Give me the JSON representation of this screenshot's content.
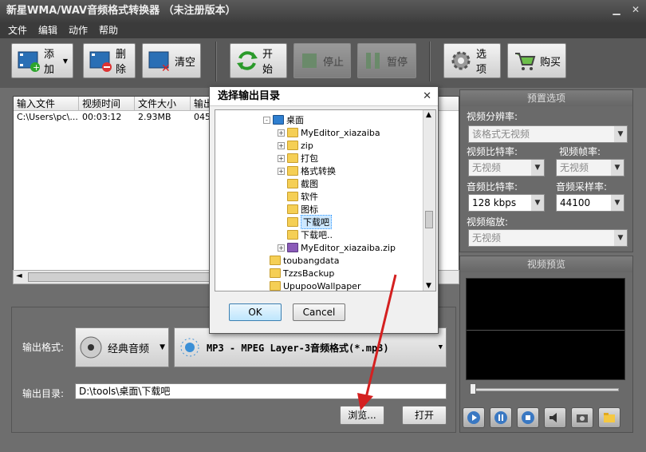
{
  "window": {
    "title": "新星WMA/WAV音频格式转换器 （未注册版本）",
    "min_icon": "minimize-icon",
    "close_icon": "close-icon"
  },
  "menu": [
    "文件",
    "编辑",
    "动作",
    "帮助"
  ],
  "toolbar": {
    "add": "添加",
    "delete": "删除",
    "clear": "清空",
    "start": "开始",
    "stop": "停止",
    "pause": "暂停",
    "options": "选项",
    "buy": "购买"
  },
  "table": {
    "columns": [
      "输入文件",
      "视频时间",
      "文件大小",
      "输出"
    ],
    "rows": [
      [
        "C:\\Users\\pc\\...",
        "00:03:12",
        "2.93MB",
        "045"
      ]
    ]
  },
  "preset": {
    "title": "预置选项",
    "video_resolution_label": "视频分辨率:",
    "video_resolution_value": "该格式无视频",
    "video_bitrate_label": "视频比特率:",
    "video_bitrate_value": "无视频",
    "video_fps_label": "视频帧率:",
    "video_fps_value": "无视频",
    "audio_bitrate_label": "音频比特率:",
    "audio_bitrate_value": "128 kbps",
    "audio_samplerate_label": "音频采样率:",
    "audio_samplerate_value": "44100",
    "video_scale_label": "视频缩放:",
    "video_scale_value": "无视频"
  },
  "preview": {
    "title": "视频预览",
    "slider_position": 0.0
  },
  "output": {
    "format_label": "输出格式:",
    "category": "经典音频",
    "format": "MP3 - MPEG Layer-3音频格式(*.mp3)",
    "dir_label": "输出目录:",
    "dir_value": "D:\\tools\\桌面\\下载吧",
    "browse": "浏览...",
    "open": "打开"
  },
  "dialog": {
    "title": "选择输出目录",
    "ok": "OK",
    "cancel": "Cancel",
    "tree": [
      {
        "label": "桌面",
        "level": 0,
        "expander": "-",
        "icon": "desktop"
      },
      {
        "label": "MyEditor_xiazaiba",
        "level": 1,
        "expander": "+",
        "icon": "folder"
      },
      {
        "label": "zip",
        "level": 1,
        "expander": "+",
        "icon": "folder"
      },
      {
        "label": "打包",
        "level": 1,
        "expander": "+",
        "icon": "folder"
      },
      {
        "label": "格式转换",
        "level": 1,
        "expander": "+",
        "icon": "folder"
      },
      {
        "label": "截图",
        "level": 1,
        "expander": "",
        "icon": "folder"
      },
      {
        "label": "软件",
        "level": 1,
        "expander": "",
        "icon": "folder"
      },
      {
        "label": "图标",
        "level": 1,
        "expander": "",
        "icon": "folder"
      },
      {
        "label": "下载吧",
        "level": 1,
        "expander": "",
        "icon": "folder",
        "selected": true
      },
      {
        "label": "下载吧..",
        "level": 1,
        "expander": "",
        "icon": "folder"
      },
      {
        "label": "MyEditor_xiazaiba.zip",
        "level": 1,
        "expander": "+",
        "icon": "zip"
      },
      {
        "label": "toubangdata",
        "level": -1,
        "expander": "",
        "icon": "folder"
      },
      {
        "label": "TzzsBackup",
        "level": -1,
        "expander": "",
        "icon": "folder"
      },
      {
        "label": "UpupooWallpaper",
        "level": -1,
        "expander": "",
        "icon": "folder"
      }
    ]
  },
  "colors": {
    "accent_arrow": "#d42020",
    "tree_selection": "#cde8ff"
  }
}
